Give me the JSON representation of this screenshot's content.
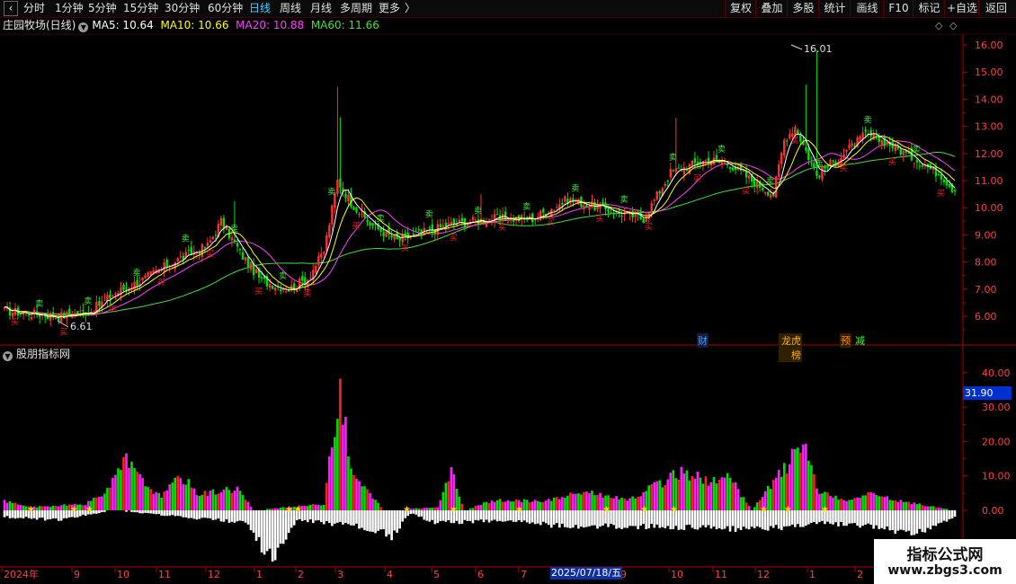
{
  "toolbar": {
    "periods": [
      "分时",
      "1分钟",
      "5分钟",
      "15分钟",
      "30分钟",
      "60分钟",
      "日线",
      "周线",
      "月线",
      "多周期",
      "更多"
    ],
    "active_period": "日线",
    "right_buttons": [
      "复权",
      "叠加",
      "多股",
      "统计",
      "画线",
      "F10",
      "标记",
      "+自选",
      "返回"
    ]
  },
  "title": {
    "stock": "庄园牧场(日线)",
    "ma5_label": "MA5: 10.64",
    "ma10_label": "MA10: 10.66",
    "ma20_label": "MA20: 10.88",
    "ma60_label": "MA60: 11.66"
  },
  "indicator": {
    "name": "股朋指标网",
    "current_value": "31.90"
  },
  "annotations": {
    "high_label": "16.01",
    "low_label": "6.61"
  },
  "events": [
    "财",
    "龙虎榜",
    "预",
    "减"
  ],
  "marker_labels": {
    "buy": "买",
    "sell": "卖"
  },
  "x_axis": {
    "labels": [
      "2024年",
      "9",
      "10",
      "11",
      "12",
      "1",
      "2",
      "3",
      "4",
      "5",
      "6",
      "7",
      "2025/07/18/五",
      "9",
      "10",
      "11",
      "12",
      "1",
      "2"
    ],
    "cursor_date": "2025/07/18/五"
  },
  "price_axis_ticks": [
    "16.00",
    "15.00",
    "14.00",
    "13.00",
    "12.00",
    "11.00",
    "10.00",
    "9.00",
    "8.00",
    "7.00",
    "6.00"
  ],
  "indicator_axis_ticks": [
    "40.00",
    "30.00",
    "20.00",
    "10.00",
    "0.00"
  ],
  "watermark": {
    "line1": "指标公式网",
    "line2": "www.zbgs3.com"
  },
  "colors": {
    "up": "#ff3030",
    "down": "#00e000",
    "ma5": "#ffffff",
    "ma10": "#ffff00",
    "ma20": "#ff40ff",
    "ma60": "#40e040",
    "axis": "#b00000",
    "active_tab": "#3fd0ff"
  }
}
